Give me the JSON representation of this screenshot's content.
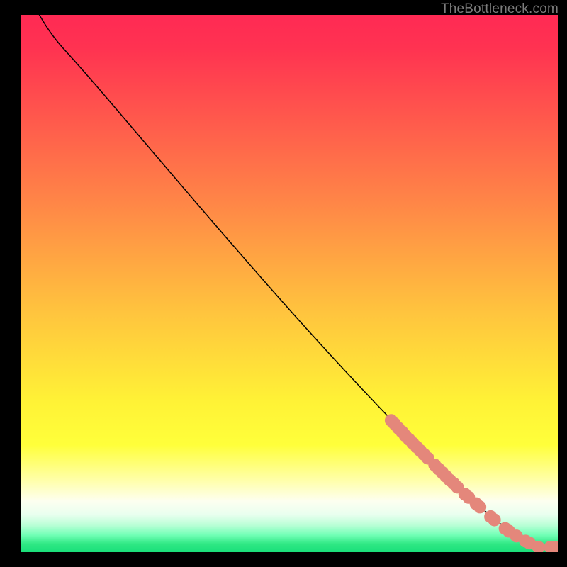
{
  "attribution": "TheBottleneck.com",
  "chart_data": {
    "type": "line",
    "title": "",
    "xlabel": "",
    "ylabel": "",
    "xlim": [
      0,
      100
    ],
    "ylim": [
      0,
      100
    ],
    "gradient_stops": [
      {
        "offset": 0.0,
        "color": "#ff2a54"
      },
      {
        "offset": 0.06,
        "color": "#ff3251"
      },
      {
        "offset": 0.35,
        "color": "#ff8647"
      },
      {
        "offset": 0.55,
        "color": "#ffc33e"
      },
      {
        "offset": 0.72,
        "color": "#fff236"
      },
      {
        "offset": 0.8,
        "color": "#ffff3a"
      },
      {
        "offset": 0.87,
        "color": "#ffffb0"
      },
      {
        "offset": 0.905,
        "color": "#fdfff0"
      },
      {
        "offset": 0.93,
        "color": "#e9ffef"
      },
      {
        "offset": 0.95,
        "color": "#b9ffd6"
      },
      {
        "offset": 0.968,
        "color": "#72ffb6"
      },
      {
        "offset": 0.985,
        "color": "#2fe884"
      },
      {
        "offset": 1.0,
        "color": "#1adf7a"
      }
    ],
    "series": [
      {
        "name": "curve",
        "type": "line",
        "color": "#000000",
        "points": [
          {
            "x": 3.5,
            "y": 100.0
          },
          {
            "x": 5.0,
            "y": 97.5
          },
          {
            "x": 7.0,
            "y": 94.8
          },
          {
            "x": 10.0,
            "y": 91.5
          },
          {
            "x": 15.0,
            "y": 85.8
          },
          {
            "x": 25.0,
            "y": 74.0
          },
          {
            "x": 40.0,
            "y": 56.5
          },
          {
            "x": 55.0,
            "y": 39.5
          },
          {
            "x": 70.0,
            "y": 23.5
          },
          {
            "x": 80.0,
            "y": 13.5
          },
          {
            "x": 88.0,
            "y": 6.2
          },
          {
            "x": 92.0,
            "y": 3.3
          },
          {
            "x": 94.5,
            "y": 1.8
          },
          {
            "x": 96.5,
            "y": 0.9
          },
          {
            "x": 99.5,
            "y": 0.9
          }
        ]
      },
      {
        "name": "highlight-dots",
        "type": "scatter",
        "color": "#e4877b",
        "points": [
          {
            "x": 69.0,
            "y": 24.5,
            "r": 1.2
          },
          {
            "x": 69.6,
            "y": 23.9,
            "r": 1.2
          },
          {
            "x": 70.3,
            "y": 23.1,
            "r": 1.2
          },
          {
            "x": 71.0,
            "y": 22.4,
            "r": 1.2
          },
          {
            "x": 71.6,
            "y": 21.7,
            "r": 1.2
          },
          {
            "x": 72.3,
            "y": 21.0,
            "r": 1.2
          },
          {
            "x": 73.0,
            "y": 20.3,
            "r": 1.2
          },
          {
            "x": 73.7,
            "y": 19.6,
            "r": 1.2
          },
          {
            "x": 74.4,
            "y": 18.9,
            "r": 1.2
          },
          {
            "x": 75.1,
            "y": 18.2,
            "r": 1.2
          },
          {
            "x": 75.8,
            "y": 17.5,
            "r": 1.2
          },
          {
            "x": 77.1,
            "y": 16.2,
            "r": 1.2
          },
          {
            "x": 77.8,
            "y": 15.5,
            "r": 1.2
          },
          {
            "x": 78.5,
            "y": 14.8,
            "r": 1.2
          },
          {
            "x": 79.2,
            "y": 14.1,
            "r": 1.2
          },
          {
            "x": 79.9,
            "y": 13.4,
            "r": 1.2
          },
          {
            "x": 80.6,
            "y": 12.8,
            "r": 1.2
          },
          {
            "x": 81.3,
            "y": 12.1,
            "r": 1.2
          },
          {
            "x": 82.7,
            "y": 10.8,
            "r": 1.2
          },
          {
            "x": 83.4,
            "y": 10.2,
            "r": 1.2
          },
          {
            "x": 84.8,
            "y": 9.0,
            "r": 1.2
          },
          {
            "x": 85.5,
            "y": 8.4,
            "r": 1.2
          },
          {
            "x": 87.5,
            "y": 6.6,
            "r": 1.2
          },
          {
            "x": 88.2,
            "y": 6.0,
            "r": 1.2
          },
          {
            "x": 90.2,
            "y": 4.4,
            "r": 1.2
          },
          {
            "x": 90.9,
            "y": 3.9,
            "r": 1.2
          },
          {
            "x": 92.3,
            "y": 3.0,
            "r": 1.2
          },
          {
            "x": 94.0,
            "y": 2.05,
            "r": 1.2
          },
          {
            "x": 94.7,
            "y": 1.7,
            "r": 1.2
          },
          {
            "x": 96.4,
            "y": 0.9,
            "r": 1.2
          },
          {
            "x": 98.6,
            "y": 0.9,
            "r": 1.2
          },
          {
            "x": 99.5,
            "y": 0.9,
            "r": 1.2
          }
        ]
      }
    ]
  }
}
